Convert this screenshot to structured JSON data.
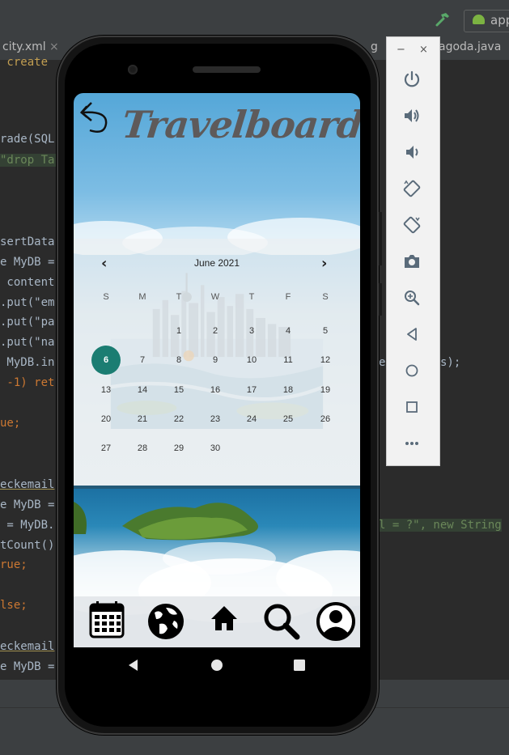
{
  "ide": {
    "tabs": [
      {
        "label": "city.xml"
      },
      {
        "label": "g"
      },
      {
        "label": "agoda.java"
      }
    ],
    "run_config": "app",
    "code_fragments": [
      {
        "text": "rade(SQL"
      },
      {
        "text": "\"drop Ta"
      },
      {
        "text": "sertData"
      },
      {
        "text": "e MyDB ="
      },
      {
        "text": " content"
      },
      {
        "text": ".put(\"em"
      },
      {
        "text": ".put(\"pa"
      },
      {
        "text": ".put(\"na"
      },
      {
        "text": " MyDB.in"
      },
      {
        "text": " -1) ret"
      },
      {
        "text": "ue;"
      },
      {
        "text": "eckemail"
      },
      {
        "text": "e MyDB ="
      },
      {
        "text": " = MyDB."
      },
      {
        "text": "tCount()"
      },
      {
        "text": "rue;"
      },
      {
        "text": "lse;"
      },
      {
        "text": "eckemail"
      },
      {
        "text": "e MyDB ="
      },
      {
        "text": "e"
      },
      {
        "text": "s);"
      },
      {
        "text": "l = ?\", new String"
      }
    ]
  },
  "app": {
    "title": "Travelboard",
    "calendar": {
      "month_label": "June 2021",
      "weekdays": [
        "S",
        "M",
        "T",
        "W",
        "T",
        "F",
        "S"
      ],
      "weeks": [
        [
          "",
          "",
          "1",
          "2",
          "3",
          "4",
          "5"
        ],
        [
          "6",
          "7",
          "8",
          "9",
          "10",
          "11",
          "12"
        ],
        [
          "13",
          "14",
          "15",
          "16",
          "17",
          "18",
          "19"
        ],
        [
          "20",
          "21",
          "22",
          "23",
          "24",
          "25",
          "26"
        ],
        [
          "27",
          "28",
          "29",
          "30",
          "",
          "",
          ""
        ]
      ],
      "selected_day": "6"
    },
    "nav": [
      {
        "icon": "calendar-icon"
      },
      {
        "icon": "globe-icon"
      },
      {
        "icon": "home-icon"
      },
      {
        "icon": "search-icon"
      },
      {
        "icon": "profile-icon"
      }
    ]
  },
  "emulator": {
    "window_minimize": "−",
    "window_close": "×",
    "buttons": [
      {
        "icon": "power-icon"
      },
      {
        "icon": "volume-up-icon"
      },
      {
        "icon": "volume-down-icon"
      },
      {
        "icon": "rotate-left-icon"
      },
      {
        "icon": "rotate-right-icon"
      },
      {
        "icon": "camera-icon"
      },
      {
        "icon": "zoom-icon"
      },
      {
        "icon": "back-icon"
      },
      {
        "icon": "home-icon"
      },
      {
        "icon": "overview-icon"
      },
      {
        "icon": "more-icon"
      }
    ]
  },
  "colors": {
    "selected_day": "#1b7d72",
    "ide_background": "#2b2b2b",
    "keyword": "#cc7832",
    "string": "#6a8759"
  }
}
